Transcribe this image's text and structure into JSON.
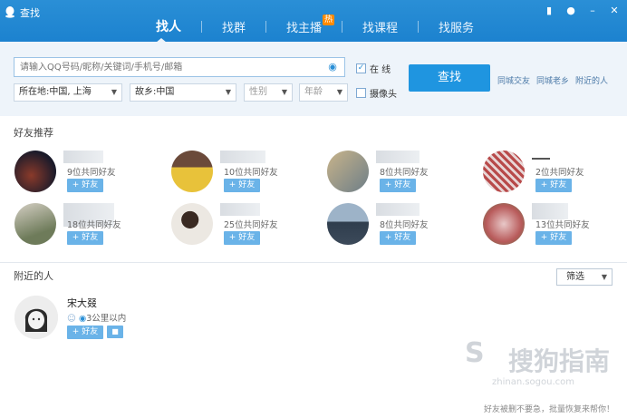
{
  "window": {
    "title": "查找"
  },
  "tabs": [
    {
      "label": "找人",
      "active": true
    },
    {
      "label": "找群",
      "active": false
    },
    {
      "label": "找主播",
      "active": false,
      "badge": "热"
    },
    {
      "label": "找课程",
      "active": false
    },
    {
      "label": "找服务",
      "active": false
    }
  ],
  "search": {
    "placeholder": "请输入QQ号码/昵称/关键词/手机号/邮箱",
    "online_label": "在 线",
    "online_checked": true,
    "camera_label": "摄像头",
    "camera_checked": false,
    "location_value": "所在地:中国, 上海",
    "hometown_value": "故乡:中国",
    "gender_placeholder": "性别",
    "age_placeholder": "年龄",
    "search_button": "查找",
    "quick_links": [
      "同城交友",
      "同城老乡",
      "附近的人"
    ]
  },
  "recommend": {
    "title": "好友推荐",
    "add_label": "+ 好友",
    "items": [
      {
        "mutual": "9位共同好友",
        "avatar_color": "#3a2a2a"
      },
      {
        "mutual": "10位共同好友",
        "avatar_color": "#c9a35a"
      },
      {
        "mutual": "8位共同好友",
        "avatar_color": "#a8b6be"
      },
      {
        "mutual": "2位共同好友",
        "avatar_color": "#c45a5a"
      },
      {
        "mutual": "18位共同好友",
        "avatar_color": "#7c8a6a"
      },
      {
        "mutual": "25位共同好友",
        "avatar_color": "#d9d2cc"
      },
      {
        "mutual": "8位共同好友",
        "avatar_color": "#4f6b8a"
      },
      {
        "mutual": "13位共同好友",
        "avatar_color": "#c77a7a"
      }
    ]
  },
  "nearby": {
    "title": "附近的人",
    "filter_label": "筛选",
    "person": {
      "name": "宋大叕",
      "distance": "3公里以内",
      "add_label": "+ 好友"
    }
  },
  "watermark": {
    "text": "搜狗指南",
    "url": "zhinan.sogou.com"
  },
  "footer_tip": "好友被删不要急，批量恢复来帮你！",
  "colors": {
    "header": "#1c82cf",
    "accent": "#1f95e0",
    "add_button": "#6ab3e8",
    "panel": "#eef4fa"
  }
}
